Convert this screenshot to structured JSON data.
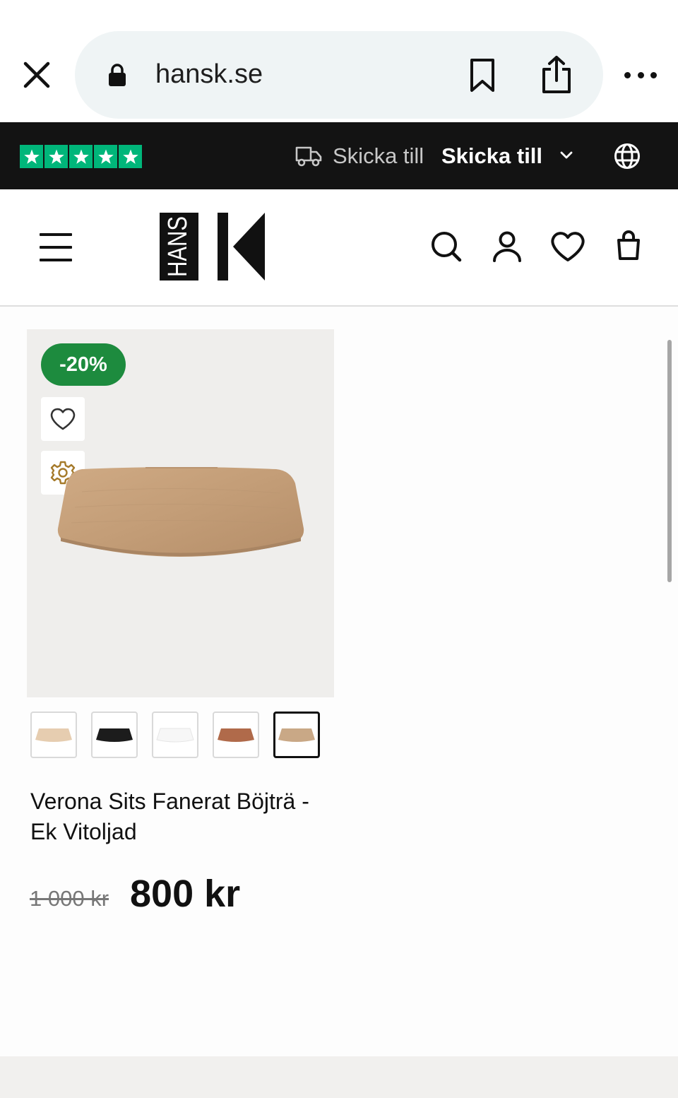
{
  "browser": {
    "url": "hansk.se",
    "icons": [
      "close-icon",
      "lock-icon",
      "bookmark-icon",
      "share-icon",
      "more-icon"
    ]
  },
  "topbar": {
    "rating_stars": 5,
    "rating_color": "#00b67a",
    "ship_label": "Skicka till",
    "ship_value": "Skicka till"
  },
  "header": {
    "logo_text": "HANS K",
    "icons": [
      "menu-icon",
      "search-icon",
      "account-icon",
      "wishlist-icon",
      "cart-icon"
    ]
  },
  "product": {
    "discount": "-20%",
    "discount_color": "#1d8b3e",
    "title": "Verona Sits Fanerat Böjträ - Ek Vitoljad",
    "old_price": "1 000 kr",
    "price": "800 kr",
    "variants": [
      {
        "color": "#e6cdb0",
        "selected": false
      },
      {
        "color": "#1c1c1c",
        "selected": false
      },
      {
        "color": "#f7f7f7",
        "selected": false
      },
      {
        "color": "#b06a4a",
        "selected": false
      },
      {
        "color": "#c9a886",
        "selected": true
      }
    ]
  }
}
